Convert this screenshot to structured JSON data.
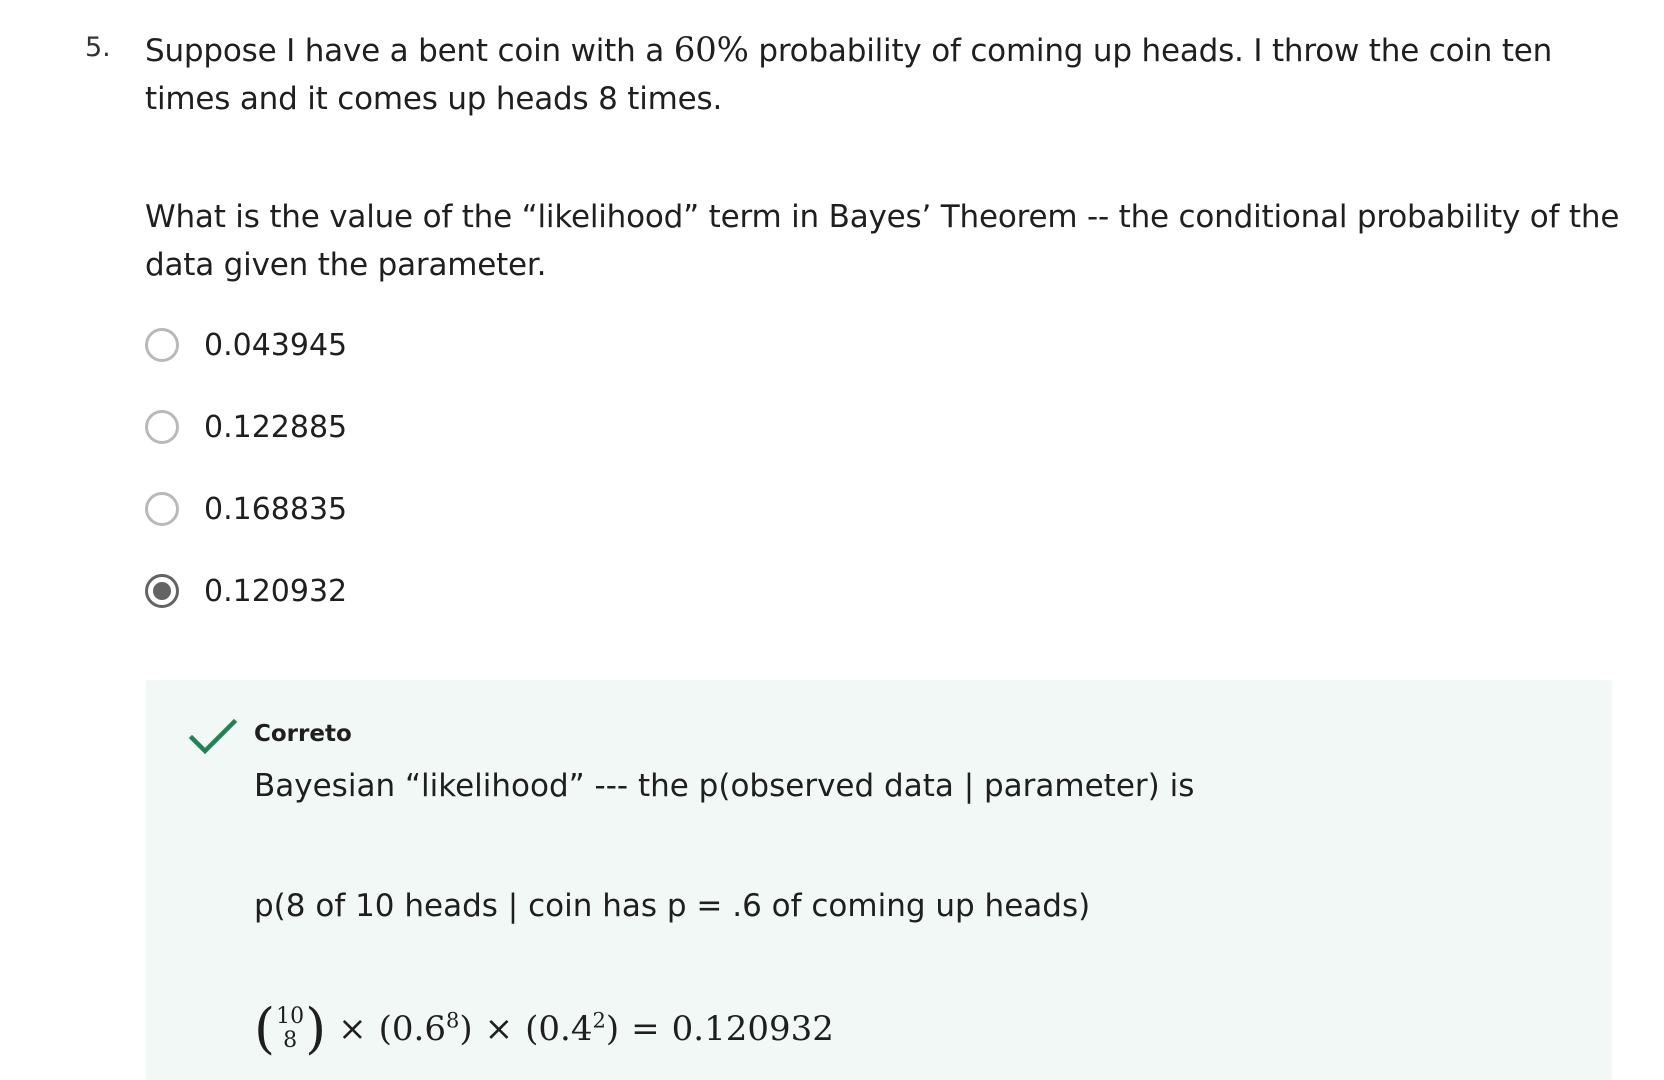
{
  "question": {
    "number": "5.",
    "prompt_part1": "Suppose I have a bent coin with a ",
    "prompt_math": "60%",
    "prompt_part2": " probability of coming up heads. I throw the coin ten times and it comes up heads 8 times.",
    "subquestion": "What is the value of the “likelihood” term in Bayes’ Theorem -- the conditional probability of the data given the parameter."
  },
  "options": [
    {
      "label": "0.043945",
      "selected": false
    },
    {
      "label": "0.122885",
      "selected": false
    },
    {
      "label": "0.168835",
      "selected": false
    },
    {
      "label": "0.120932",
      "selected": true
    }
  ],
  "feedback": {
    "status": "Correto",
    "line1": "Bayesian “likelihood” --- the p(observed data | parameter) is",
    "line2": "p(8 of 10 heads | coin has p = .6 of coming up heads)",
    "formula": {
      "binom_n": "10",
      "binom_k": "8",
      "times": "×",
      "term1_base": "(0.6",
      "term1_exp": "8",
      "term1_close": ")",
      "term2_base": "(0.4",
      "term2_exp": "2",
      "term2_close": ")",
      "equals": "=",
      "result": "0.120932"
    }
  },
  "colors": {
    "check": "#1f8354",
    "feedback_bg": "#f2f8f6",
    "radio_border": "#b9b9b9",
    "radio_selected": "#636363"
  }
}
